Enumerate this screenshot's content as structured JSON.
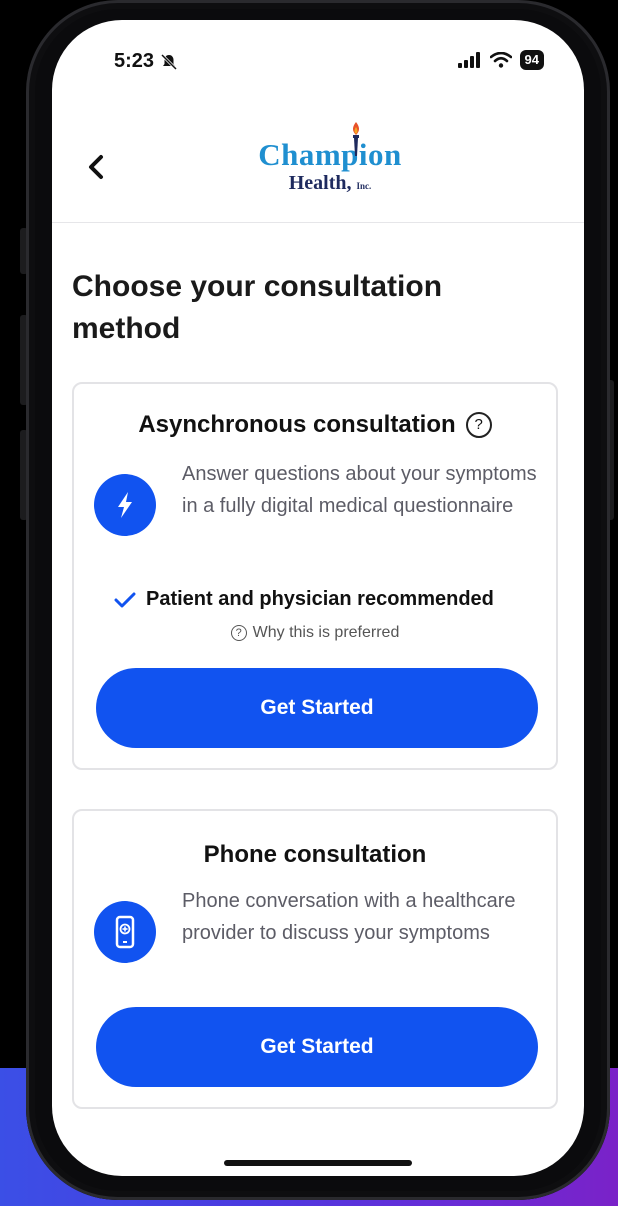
{
  "status_bar": {
    "time": "5:23",
    "battery": "94"
  },
  "header": {
    "logo_line1": "Champion",
    "logo_line2": "Health,",
    "logo_suffix": "Inc."
  },
  "page": {
    "title": "Choose your consultation method"
  },
  "cards": [
    {
      "title": "Asynchronous consultation",
      "description": "Answer questions about your symptoms in a fully digital medical questionnaire",
      "recommendation": "Patient and physician recommended",
      "why_link": "Why this is preferred",
      "cta": "Get Started",
      "icon": "lightning-icon"
    },
    {
      "title": "Phone consultation",
      "description": "Phone conversation with a healthcare provider to discuss your symptoms",
      "cta": "Get Started",
      "icon": "phone-icon"
    }
  ],
  "colors": {
    "primary": "#1153f0",
    "logo_blue": "#1f8fd0",
    "logo_navy": "#1e2a5e",
    "backdrop": "#4b3ae0"
  }
}
